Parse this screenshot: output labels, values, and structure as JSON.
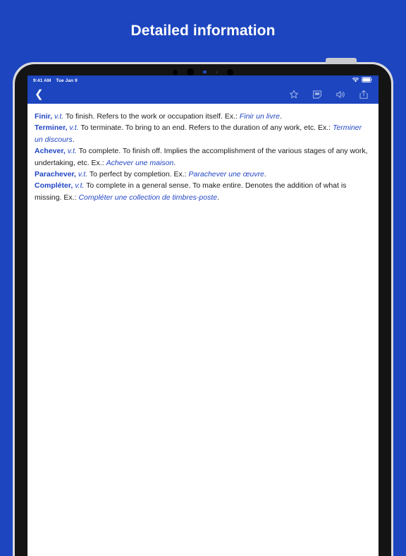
{
  "header": {
    "title": "Detailed information"
  },
  "device": {
    "status_bar": {
      "time": "9:41 AM",
      "date": "Tue Jan 9",
      "wifi_icon": "wifi-icon",
      "battery_icon": "battery-full-icon"
    },
    "nav_bar": {
      "back_icon": "chevron-left-icon",
      "actions": [
        {
          "name": "bookmark-star-icon",
          "label": "Favorite"
        },
        {
          "name": "note-icon",
          "label": "Note"
        },
        {
          "name": "speaker-icon",
          "label": "Pronounce"
        },
        {
          "name": "share-icon",
          "label": "Share"
        }
      ]
    }
  },
  "article": {
    "entries": [
      {
        "headword": "Finir,",
        "pos": "v.t.",
        "definition": " To finish. Refers to the work or occupation itself. Ex.: ",
        "example": "Finir un livre",
        "tail": "."
      },
      {
        "headword": "Terminer,",
        "pos": "v.t.",
        "definition": " To terminate. To bring to an end. Refers to the duration of any work, etc. Ex.: ",
        "example": "Terminer un discours",
        "tail": "."
      },
      {
        "headword": "Achever,",
        "pos": "v.t.",
        "definition": " To complete. To finish off. Implies the accomplishment of the various stages of any work, undertaking, etc. Ex.: ",
        "example": "Achever une maison",
        "tail": "."
      },
      {
        "headword": "Parachever,",
        "pos": "v.t.",
        "definition": " To perfect by completion. Ex.: ",
        "example": "Parachever une œuvre",
        "tail": "."
      },
      {
        "headword": "Compléter,",
        "pos": "v.t.",
        "definition": " To complete in a general sense. To make entire. Denotes the addition of what is missing. Ex.: ",
        "example": "Compléter une collection de timbres-poste",
        "tail": "."
      }
    ]
  },
  "colors": {
    "background_blue": "#1c45bf",
    "accent_blue": "#2145c4",
    "body_text": "#1a1a1a",
    "device_frame": "#d8d9dd",
    "bezel": "#141414"
  }
}
